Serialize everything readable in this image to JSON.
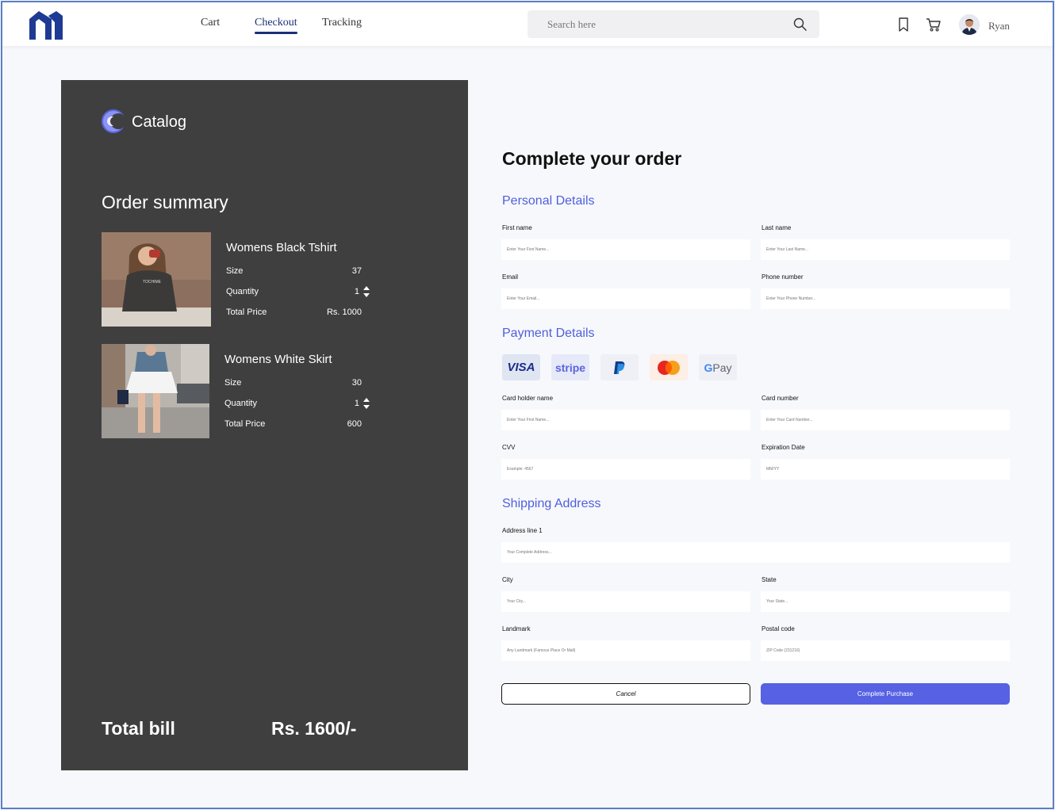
{
  "nav": {
    "links": [
      "Cart",
      "Checkout",
      "Tracking"
    ],
    "active": "Checkout",
    "search_placeholder": "Search here",
    "username": "Ryan"
  },
  "summary": {
    "brand": "Catalog",
    "title": "Order summary",
    "items": [
      {
        "name": "Womens Black Tshirt",
        "size_label": "Size",
        "size": "37",
        "qty_label": "Quantity",
        "qty": "1",
        "price_label": "Total Price",
        "price": "Rs. 1000"
      },
      {
        "name": "Womens White Skirt",
        "size_label": "Size",
        "size": "30",
        "qty_label": "Quantity",
        "qty": "1",
        "price_label": "Total Price",
        "price": "600"
      }
    ],
    "total_label": "Total bill",
    "total_value": "Rs. 1600/-"
  },
  "form": {
    "title": "Complete your order",
    "personal": {
      "title": "Personal Details",
      "first_name_label": "First name",
      "first_name_placeholder": "Enter Your First Name...",
      "last_name_label": "Last name",
      "last_name_placeholder": "Enter Your Last Name...",
      "email_label": "Email",
      "email_placeholder": "Enter Your Email...",
      "phone_label": "Phone number",
      "phone_placeholder": "Enter Your Phone Number..."
    },
    "payment": {
      "title": "Payment Details",
      "methods": [
        "VISA",
        "stripe",
        "PayPal",
        "Mastercard",
        "G Pay"
      ],
      "visa_text": "VISA",
      "stripe_text": "stripe",
      "gpay_g": "G",
      "gpay_text": "Pay",
      "holder_label": "Card holder name",
      "holder_placeholder": "Enter Your First Name...",
      "number_label": "Card number",
      "number_placeholder": "Enter Your Card Number...",
      "cvv_label": "CVV",
      "cvv_placeholder": "Example: 4567",
      "expiry_label": "Expiration Date",
      "expiry_placeholder": "MM/YY"
    },
    "shipping": {
      "title": "Shipping Address",
      "address_label": "Address line 1",
      "address_placeholder": "Your Complete Address...",
      "city_label": "City",
      "city_placeholder": "Your City...",
      "state_label": "State",
      "state_placeholder": "Your State...",
      "landmark_label": "Landmark",
      "landmark_placeholder": "Any Landmark (Famous Place Or Mall)",
      "postal_label": "Postal code",
      "postal_placeholder": "ZIP Code (231216)"
    },
    "cancel_label": "Cancel",
    "complete_label": "Complete Purchase"
  },
  "colors": {
    "accent": "#4f5fdc",
    "button": "#5662e3",
    "nav_active": "#1a2f7a",
    "panel": "#3f3f3f",
    "frame_border": "#5b80c2"
  }
}
